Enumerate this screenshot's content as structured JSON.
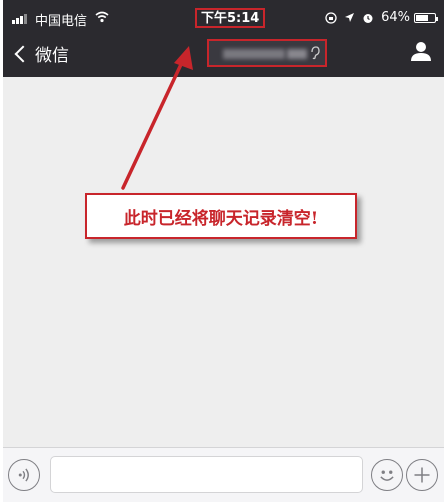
{
  "status_bar": {
    "carrier": "中国电信",
    "time": "下午5:14",
    "battery": "64%",
    "battery_level": 0.64,
    "icons": [
      "signal-icon",
      "wifi-icon",
      "lock-rotation-icon",
      "location-icon",
      "alarm-icon",
      "battery-icon"
    ]
  },
  "nav": {
    "back_label": "微信",
    "icons": [
      "chevron-left-icon",
      "earpiece-icon",
      "person-icon"
    ]
  },
  "annotation": {
    "text": "此时已经将聊天记录清空!",
    "color": "#c8252b"
  },
  "input_bar": {
    "icons": [
      "voice-icon",
      "emoji-icon",
      "plus-icon"
    ]
  },
  "colors": {
    "topbar": "#2b2a2f",
    "chat_bg": "#eeeeee",
    "highlight": "#c8252b"
  }
}
